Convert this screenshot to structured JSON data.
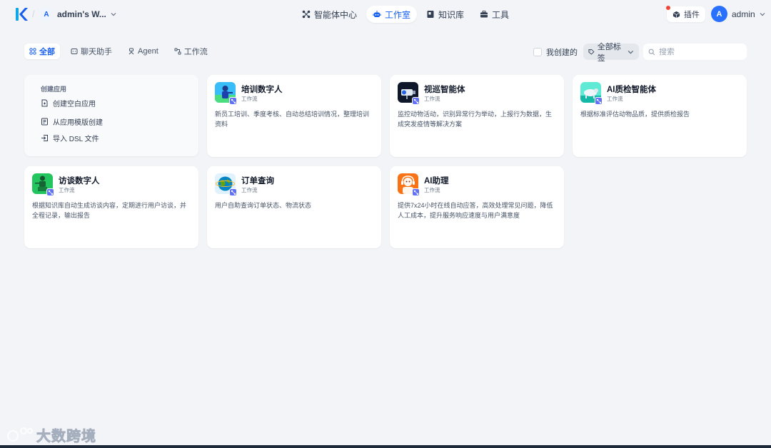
{
  "header": {
    "workspace_initial": "A",
    "workspace_name": "admin's W...",
    "nav": [
      {
        "label": "智能体中心",
        "icon": "nodes-icon"
      },
      {
        "label": "工作室",
        "icon": "robot-icon",
        "active": true
      },
      {
        "label": "知识库",
        "icon": "book-icon"
      },
      {
        "label": "工具",
        "icon": "toolbox-icon"
      }
    ],
    "plugin_label": "插件",
    "user_initial": "A",
    "user_name": "admin"
  },
  "filters": [
    {
      "label": "全部",
      "icon": "grid-icon",
      "active": true
    },
    {
      "label": "聊天助手",
      "icon": "chat-icon"
    },
    {
      "label": "Agent",
      "icon": "agent-icon"
    },
    {
      "label": "工作流",
      "icon": "workflow-icon"
    }
  ],
  "toolbar": {
    "mine_label": "我创建的",
    "tags_label": "全部标签",
    "search_placeholder": "搜索"
  },
  "create": {
    "title": "创建应用",
    "items": [
      {
        "label": "创建空白应用",
        "icon": "new-file-icon"
      },
      {
        "label": "从应用模版创建",
        "icon": "template-icon"
      },
      {
        "label": "导入 DSL 文件",
        "icon": "import-icon"
      }
    ]
  },
  "apps": [
    {
      "title": "培训数字人",
      "type": "工作流",
      "desc": "新员工培训、季度考核、自动总结培训情况，整理培训资料",
      "icon": "trainer-avatar-icon"
    },
    {
      "title": "视巡智能体",
      "type": "工作流",
      "desc": "监控动物活动，识别异常行为举动，上报行为数据，生成突发疫情等解决方案",
      "icon": "camera-avatar-icon"
    },
    {
      "title": "AI质检智能体",
      "type": "工作流",
      "desc": "根据标准评估动物品质，提供质检报告",
      "icon": "cattle-avatar-icon"
    },
    {
      "title": "访谈数字人",
      "type": "工作流",
      "desc": "根据知识库自动生成访谈内容，定期进行用户访谈，并全程记录，输出报告",
      "icon": "interviewer-avatar-icon"
    },
    {
      "title": "订单查询",
      "type": "工作流",
      "desc": "用户自助查询订单状态、物流状态",
      "icon": "globe-avatar-icon"
    },
    {
      "title": "AI助理",
      "type": "工作流",
      "desc": "提供7x24小时在线自动应答，高效处理常见问题，降低人工成本，提升服务响应速度与用户满意度",
      "icon": "agent-avatar-icon"
    }
  ],
  "watermark": "大数跨境",
  "colors": {
    "accent": "#155eef",
    "badge": "#6172f3",
    "background": "#f2f4f7"
  }
}
